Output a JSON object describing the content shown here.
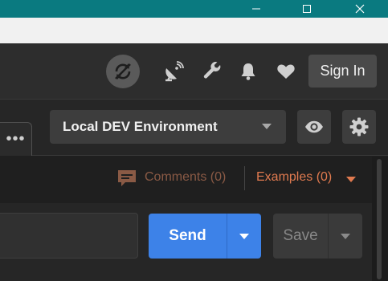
{
  "window": {
    "titlebar_color": "#0a7a80",
    "controls": [
      "minimize-icon",
      "maximize-icon",
      "close-icon"
    ]
  },
  "header": {
    "icons": [
      "sync-off-icon",
      "satellite-dish-icon",
      "wrench-icon",
      "bell-icon",
      "heart-icon"
    ],
    "sign_in_label": "Sign In"
  },
  "environment": {
    "tab_overflow_label": "•••",
    "selected": "Local DEV Environment",
    "quick_look_icon": "eye-icon",
    "settings_icon": "gear-icon"
  },
  "request_meta": {
    "comments_label": "Comments (0)",
    "examples_label": "Examples (0)",
    "accent_color": "#e07a4f"
  },
  "request": {
    "url_value": "",
    "send_label": "Send",
    "save_label": "Save",
    "send_color": "#3d82e8"
  }
}
